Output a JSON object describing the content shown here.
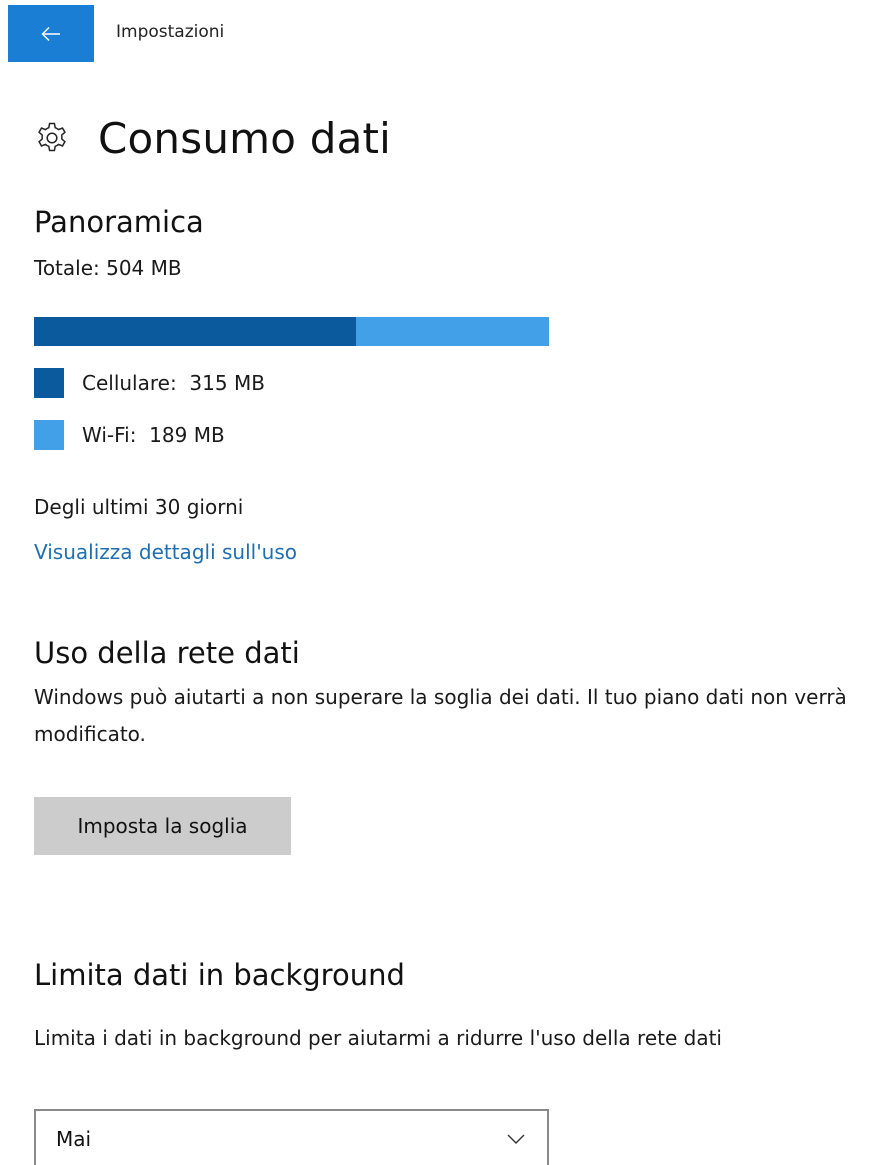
{
  "app": {
    "title": "Impostazioni"
  },
  "page": {
    "title": "Consumo dati"
  },
  "overview": {
    "heading": "Panoramica",
    "total": "Totale: 504 MB",
    "bar": {
      "cellular_mb": 315,
      "wifi_mb": 189,
      "cellular_color": "#0b5a9e",
      "wifi_color": "#41a0e8"
    },
    "legend": [
      {
        "label": "Cellulare:  315 MB",
        "color": "#0b5a9e"
      },
      {
        "label": "Wi-Fi:  189 MB",
        "color": "#41a0e8"
      }
    ],
    "period": "Degli ultimi 30 giorni",
    "details_link": "Visualizza dettagli sull'uso"
  },
  "network": {
    "heading": "Uso della rete dati",
    "description": "Windows può aiutarti a non superare la soglia dei dati. Il tuo piano dati non verrà modificato.",
    "button_label": "Imposta la soglia"
  },
  "background": {
    "heading": "Limita dati in background",
    "description": "Limita i dati in background per aiutarmi a ridurre l'uso della rete dati",
    "select_value": "Mai"
  },
  "colors": {
    "accent": "#1a7fd4",
    "link": "#1f6fb0",
    "button_bg": "#cccccc"
  },
  "icons": {
    "back": "back-arrow-icon",
    "settings": "gear-icon",
    "dropdown": "chevron-down-icon"
  }
}
